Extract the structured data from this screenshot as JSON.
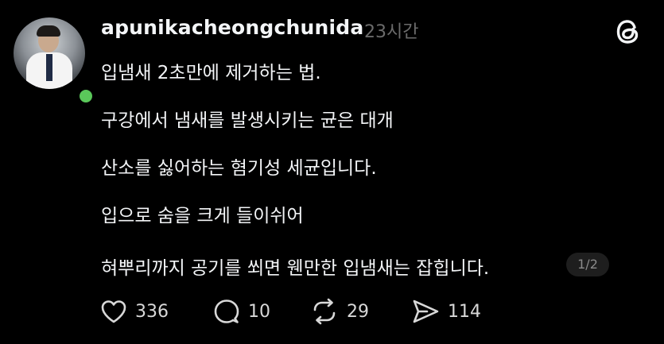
{
  "post": {
    "username": "apunikacheongchunida",
    "timestamp": "23시간",
    "lines": [
      "입냄새 2초만에 제거하는 법.",
      "구강에서 냄새를 발생시키는 균은 대개",
      "산소를 싫어하는 혐기성 세균입니다.",
      "입으로 숨을 크게 들이쉬어",
      "혀뿌리까지 공기를 쐬면 웬만한 입냄새는 잡힙니다."
    ],
    "page_indicator": "1/2"
  },
  "actions": {
    "likes": "336",
    "replies": "10",
    "reposts": "29",
    "shares": "114"
  },
  "icons": {
    "logo": "threads-logo-icon",
    "like": "heart-icon",
    "reply": "comment-icon",
    "repost": "repost-icon",
    "share": "send-icon"
  },
  "colors": {
    "background": "#000000",
    "text": "#f3f5f7",
    "muted": "#6b6b6b",
    "online": "#5ac85a"
  }
}
